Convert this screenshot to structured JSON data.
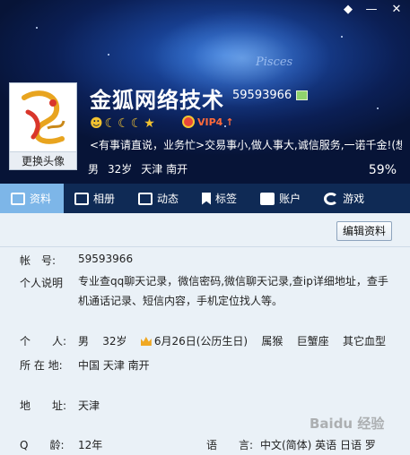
{
  "window": {
    "skin_icon": "skin-icon",
    "min_icon": "minimize-icon",
    "close_icon": "close-icon"
  },
  "header": {
    "decor_text": "Pisces",
    "avatar_button": "更换头像",
    "nickname": "金狐网络技术",
    "qq_number": "59593966",
    "vip_label": "VIP4",
    "signature": "<有事请直说，业务忙>交易事小,做人事大,诚信服务,一诺千金!(想...",
    "gender": "男",
    "age": "32岁",
    "location": "天津 南开",
    "percent": "59%"
  },
  "tabs": [
    {
      "label": "资料",
      "icon": "profile-card-icon"
    },
    {
      "label": "相册",
      "icon": "photo-album-icon"
    },
    {
      "label": "动态",
      "icon": "feed-icon"
    },
    {
      "label": "标签",
      "icon": "bookmark-tag-icon"
    },
    {
      "label": "账户",
      "icon": "wallet-icon"
    },
    {
      "label": "游戏",
      "icon": "game-icon"
    }
  ],
  "profile": {
    "edit_button": "编辑资料",
    "account_label": "帐　号:",
    "account_value": "59593966",
    "bio_label": "个人说明",
    "bio_value": "专业查qq聊天记录，微信密码,微信聊天记录,查ip详细地址，查手机通话记录、短信内容，手机定位找人等。",
    "personal_label": "个　　人:",
    "personal_gender": "男",
    "personal_age": "32岁",
    "personal_birthday": "6月26日(公历生日)",
    "personal_zodiac": "属猴",
    "personal_sign": "巨蟹座",
    "personal_blood": "其它血型",
    "location_label": "所 在 地:",
    "location_value": "中国 天津 南开",
    "address_label": "地　　址:",
    "address_value": "天津",
    "qage_label": "Q　　龄:",
    "qage_value": "12年",
    "lang_label": "语　　言:",
    "lang_value": "中文(简体)  英语  日语  罗"
  },
  "watermark": "Baidu 经验",
  "colors": {
    "tab_bar": "#0f2a55",
    "tab_active": "#7db6e8",
    "content_bg": "#eaf1f7",
    "vip": "#ff6a3a"
  }
}
